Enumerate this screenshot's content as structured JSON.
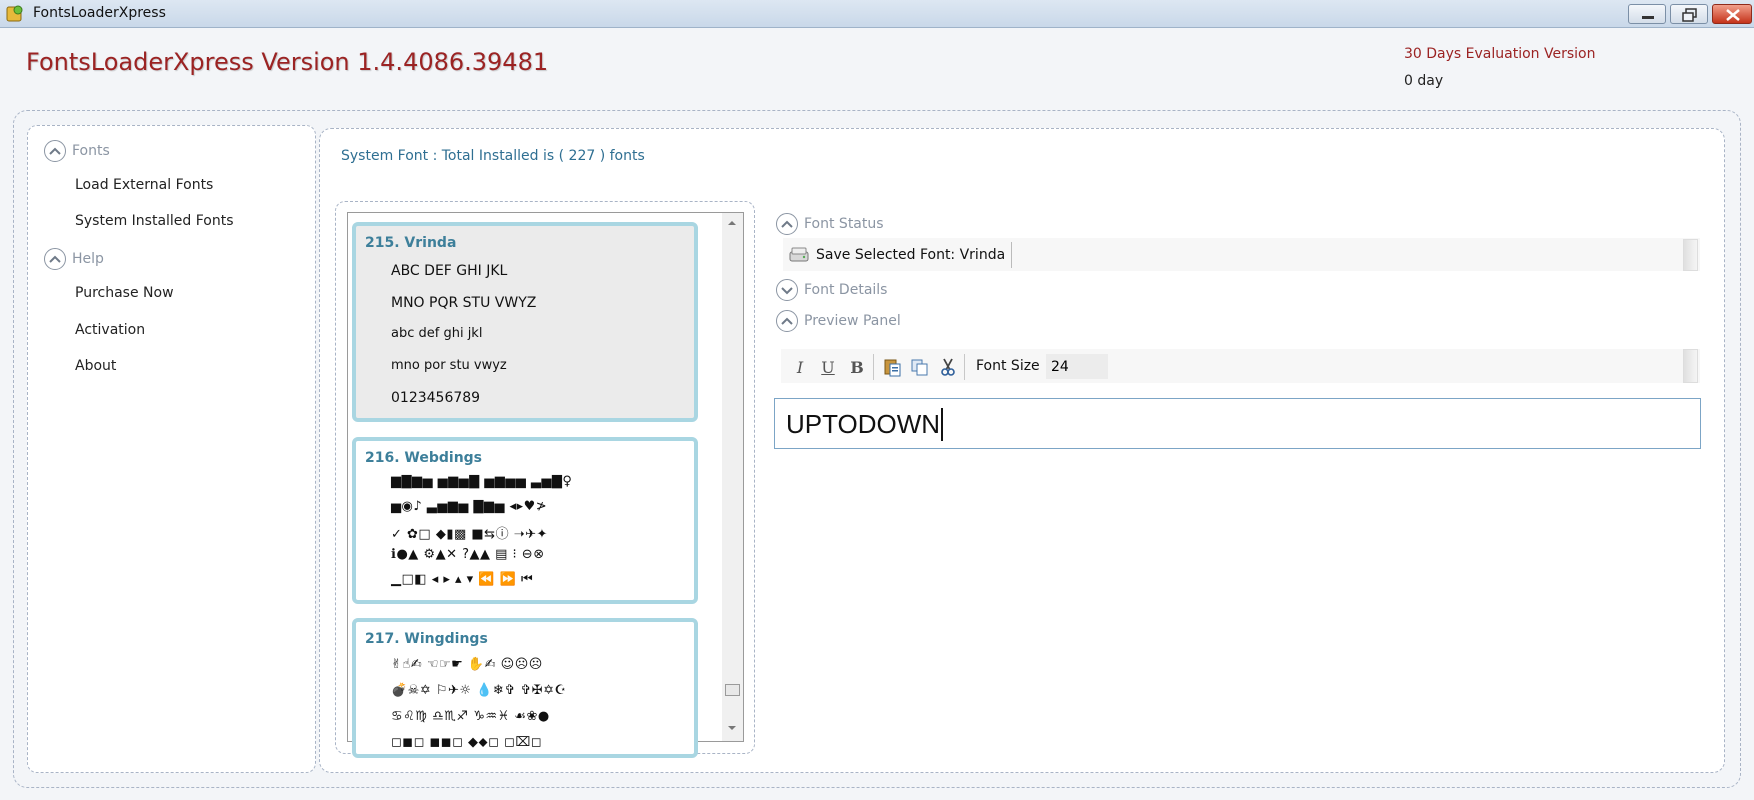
{
  "window": {
    "title": "FontsLoaderXpress"
  },
  "header": {
    "app_title": "FontsLoaderXpress Version 1.4.4086.39481",
    "evaluation": "30 Days Evaluation Version",
    "days": "0 day"
  },
  "sidebar": {
    "fonts_section": "Fonts",
    "fonts_items": [
      "Load External Fonts",
      "System Installed Fonts"
    ],
    "help_section": "Help",
    "help_items": [
      "Purchase Now",
      "Activation",
      "About"
    ]
  },
  "main": {
    "system_font_text": "System Font : Total Installed is ( 227 ) fonts",
    "font_list": [
      {
        "title": "215.  Vrinda",
        "lines": [
          "ABC  DEF  GHI  JKL",
          "MNO  PQR  STU  VWYZ",
          "abc  def  ghi  jkl",
          "mno  por  stu  vwyz",
          "0123456789"
        ]
      },
      {
        "title": "216.  Webdings",
        "lines": [
          "▆▇▆▅  ▅▆▅▇  ▅▆▅▅  ▃▅▇♀",
          "▅◉♪  ▃▅▆▅  ▇▆▅  ◂▸♥≯",
          "✓ ✿□  ◆▮▩  ■⇆ⓘ  ➝✈✦",
          "ℹ●▲  ⚙▲✕  ?▲▲  ▤ ⁝ ⊖⊗",
          "▁□◧ ◂ ▸ ▴ ▾ ⏪ ⏩ ⏮"
        ]
      },
      {
        "title": "217.  Wingdings",
        "lines": [
          "✌☝✍  ☜☞☛  ✋✍  ☺☹☹",
          "💣☠✡  ⚐✈☼  💧❄✞  ✞✠✡☪",
          "♋♌♍  ♎♏♐  ♑♒♓  ☙❀●",
          "◻◼◻  ◼◼◻  ◆⬥◻  ◻⌧◻"
        ]
      }
    ],
    "font_status": "Font Status",
    "save_selected": "Save Selected Font: Vrinda",
    "font_details": "Font Details",
    "preview_panel": "Preview Panel",
    "toolbar": {
      "italic": "I",
      "underline": "U",
      "bold": "B",
      "font_size_label": "Font Size",
      "font_size_value": "24"
    },
    "preview_text": "UPTODOWN"
  },
  "colors": {
    "title_red": "#9b2323",
    "link_blue": "#2f6f92",
    "card_border": "#a9d6e2",
    "card_title": "#3d7f9a"
  }
}
